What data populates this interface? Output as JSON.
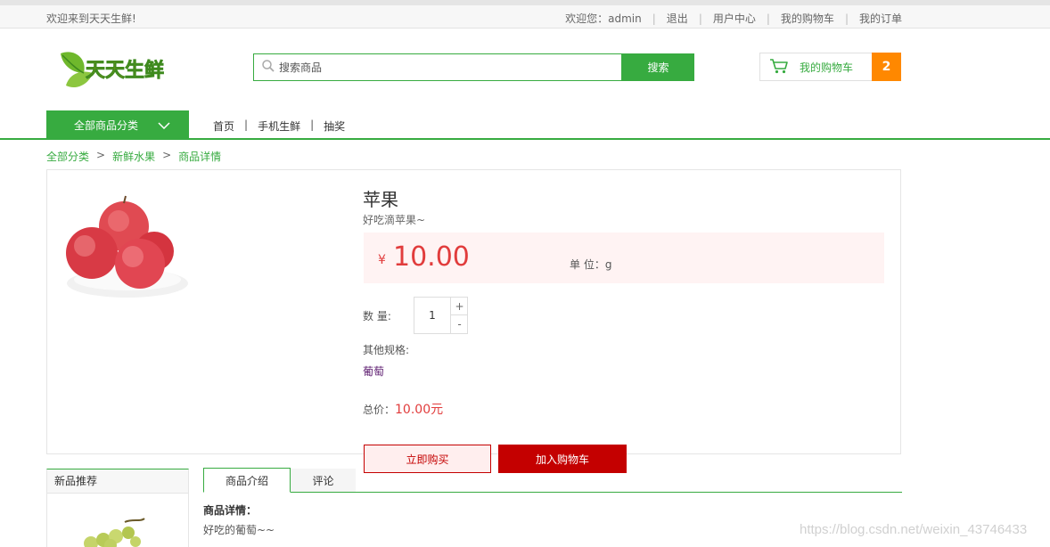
{
  "topbar": {
    "welcome": "欢迎来到天天生鲜!",
    "greeting": "欢迎您：",
    "username": "admin",
    "links": [
      "退出",
      "用户中心",
      "我的购物车",
      "我的订单"
    ]
  },
  "logo": {
    "text": "天天生鲜"
  },
  "search": {
    "placeholder": "搜索商品",
    "button": "搜索"
  },
  "cart": {
    "label": "我的购物车",
    "count": "2"
  },
  "nav": {
    "all_categories": "全部商品分类",
    "links": [
      "首页",
      "手机生鲜",
      "抽奖"
    ]
  },
  "breadcrumb": [
    "全部分类",
    "新鲜水果",
    "商品详情"
  ],
  "product": {
    "name": "苹果",
    "desc": "好吃滴苹果~",
    "currency": "¥",
    "price": "10.00",
    "unit_label": "单  位：g",
    "qty_label": "数 量:",
    "qty": "1",
    "plus": "+",
    "minus": "-",
    "spec_label": "其他规格:",
    "spec_item": "葡萄",
    "total_label": "总价：",
    "total_value": "10.00元",
    "buy_now": "立即购买",
    "add_cart": "加入购物车"
  },
  "sidebar": {
    "title": "新品推荐"
  },
  "tabs": [
    "商品介绍",
    "评论"
  ],
  "detail": {
    "title": "商品详情：",
    "text": "好吃的葡萄~~"
  },
  "watermark": "https://blog.csdn.net/weixin_43746433",
  "colors": {
    "brand_green": "#37ab40",
    "price_red": "#e13c3c",
    "cart_orange": "#ff8800",
    "buy_red": "#c40000"
  }
}
